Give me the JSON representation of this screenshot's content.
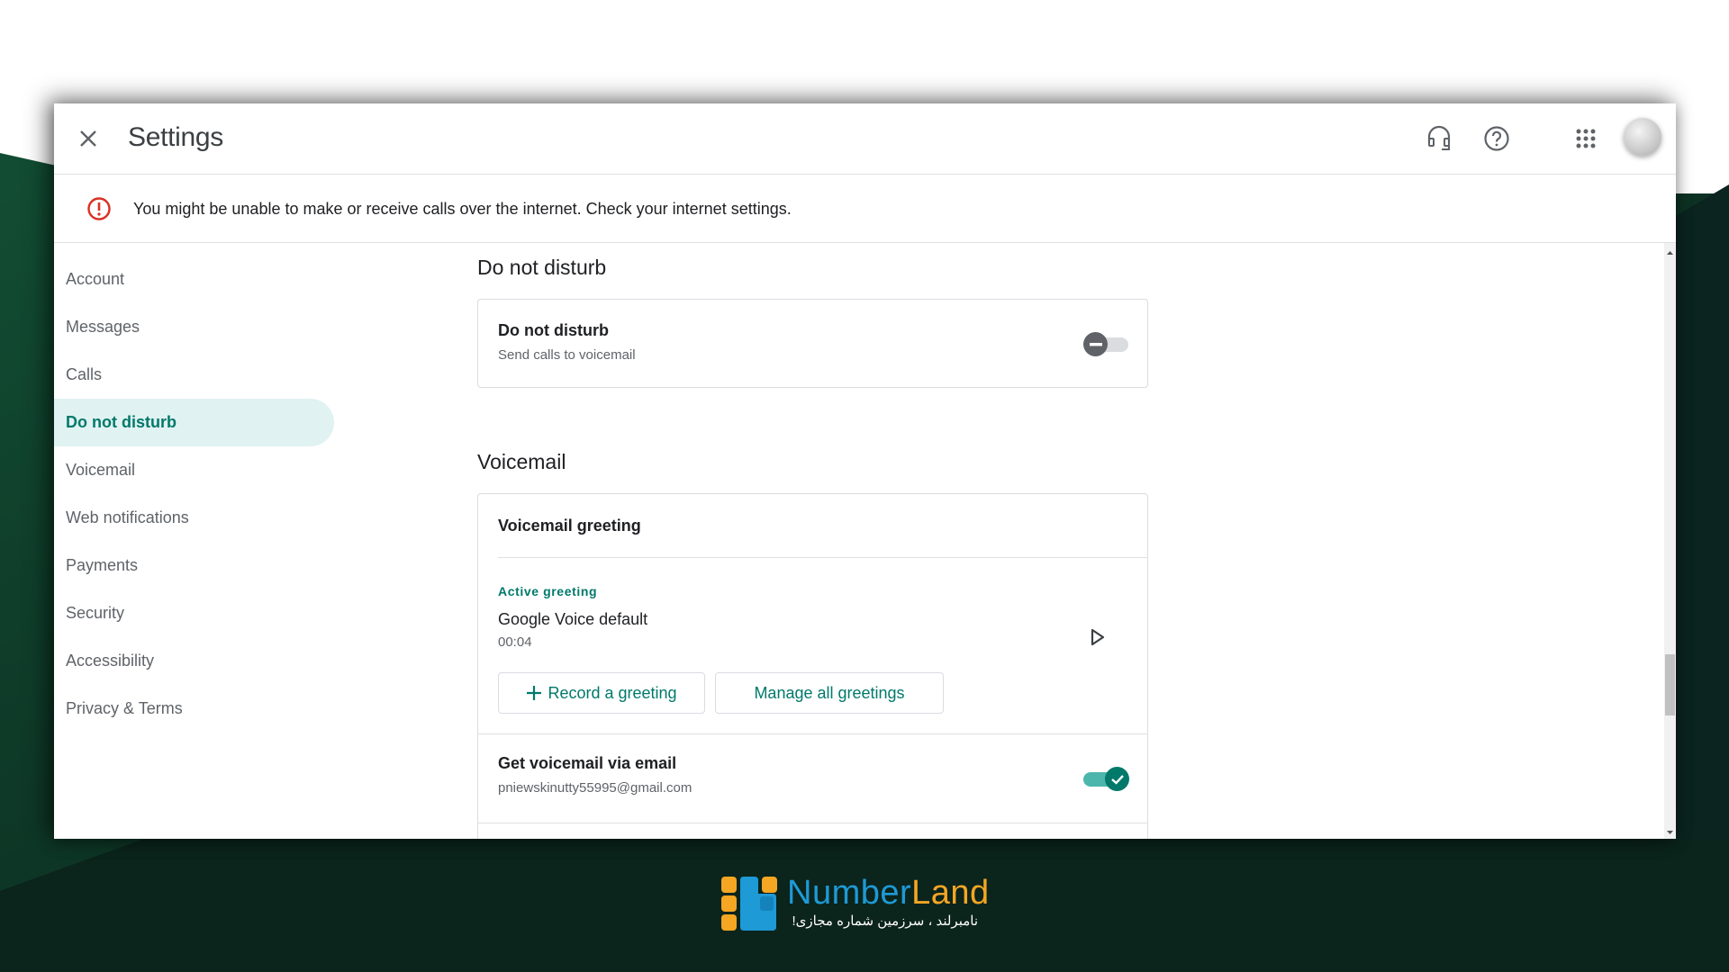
{
  "header": {
    "title": "Settings",
    "close_icon": "close-icon",
    "icons": [
      "headset-icon",
      "help-icon",
      "apps-grid-icon",
      "avatar"
    ]
  },
  "banner": {
    "icon": "error-icon",
    "text": "You might be unable to make or receive calls over the internet. Check your internet settings.",
    "icon_color": "#d93025"
  },
  "sidebar": {
    "items": [
      {
        "label": "Account",
        "active": false
      },
      {
        "label": "Messages",
        "active": false
      },
      {
        "label": "Calls",
        "active": false
      },
      {
        "label": "Do not disturb",
        "active": true
      },
      {
        "label": "Voicemail",
        "active": false
      },
      {
        "label": "Web notifications",
        "active": false
      },
      {
        "label": "Payments",
        "active": false
      },
      {
        "label": "Security",
        "active": false
      },
      {
        "label": "Accessibility",
        "active": false
      },
      {
        "label": "Privacy & Terms",
        "active": false
      }
    ]
  },
  "dnd": {
    "section_title": "Do not disturb",
    "title": "Do not disturb",
    "subtitle": "Send calls to voicemail",
    "enabled": false
  },
  "voicemail": {
    "section_title": "Voicemail",
    "greeting_title": "Voicemail greeting",
    "active_label": "Active greeting",
    "greeting_name": "Google Voice default",
    "greeting_duration": "00:04",
    "record_button": "Record a greeting",
    "manage_button": "Manage all greetings",
    "email_title": "Get voicemail via email",
    "email_address": "pniewskinutty55995@gmail.com",
    "email_enabled": true
  },
  "branding": {
    "logo_name_part1": "Number",
    "logo_name_part2": "Land",
    "tagline": "نامبرلند ، سرزمین شماره مجازی!",
    "colors": {
      "blue": "#1e9ad6",
      "orange": "#f5a623",
      "accent_green": "#00796b",
      "bg_green": "#0f3b2a"
    }
  }
}
